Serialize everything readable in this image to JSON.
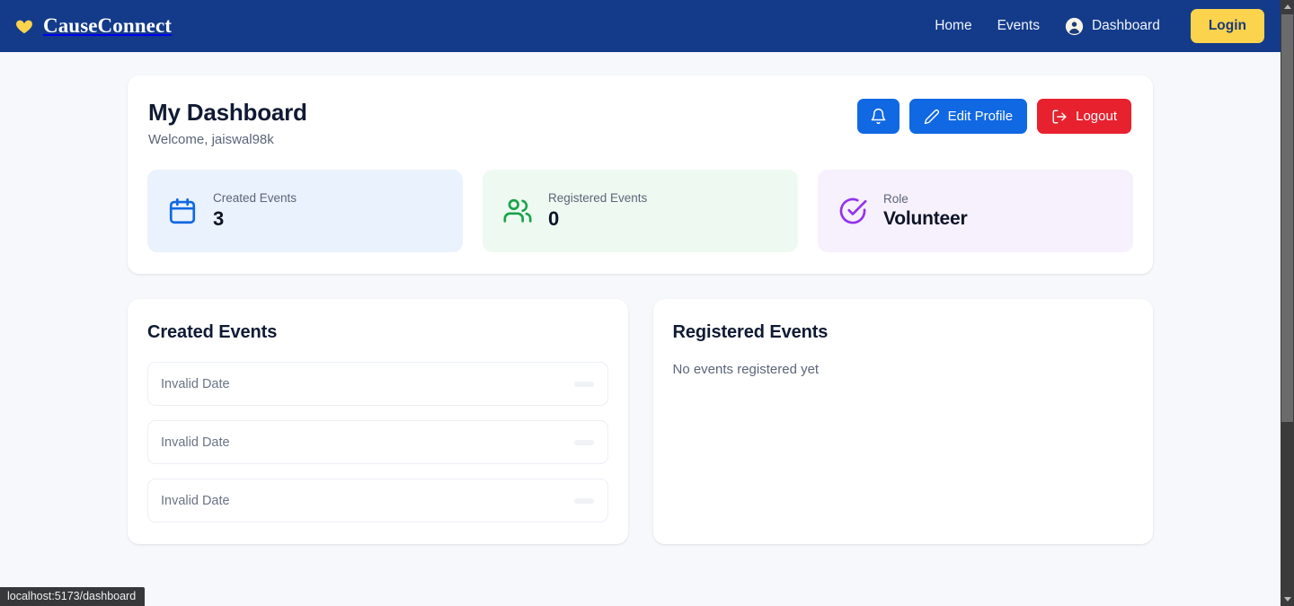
{
  "navbar": {
    "brand": "CauseConnect",
    "brand_icon": "heart-icon",
    "links": [
      {
        "label": "Home",
        "name": "home"
      },
      {
        "label": "Events",
        "name": "events"
      }
    ],
    "dashboard_label": "Dashboard",
    "dashboard_icon": "user-circle-icon",
    "login_label": "Login",
    "bg_color": "#143b8a",
    "login_bg": "#fcd34d",
    "heart_color": "#fcd34d"
  },
  "dashboard": {
    "title": "My Dashboard",
    "welcome": "Welcome, jaiswal98k",
    "buttons": {
      "notifications_icon": "bell-icon",
      "edit_profile_label": "Edit Profile",
      "edit_profile_icon": "pencil-icon",
      "logout_label": "Logout",
      "logout_icon": "sign-out-icon",
      "blue": "#1168e3",
      "red": "#e8212f"
    },
    "stats": [
      {
        "label": "Created Events",
        "value": "3",
        "icon": "calendar-icon",
        "icon_color": "#1168e3",
        "bg": "#eaf2fd"
      },
      {
        "label": "Registered Events",
        "value": "0",
        "icon": "users-icon",
        "icon_color": "#1aa34a",
        "bg": "#eefaf1"
      },
      {
        "label": "Role",
        "value": "Volunteer",
        "icon": "check-circle-icon",
        "icon_color": "#9333ea",
        "bg": "#f7f0fd"
      }
    ]
  },
  "created_events": {
    "title": "Created Events",
    "rows": [
      {
        "date": "Invalid Date",
        "badge": ""
      },
      {
        "date": "Invalid Date",
        "badge": ""
      },
      {
        "date": "Invalid Date",
        "badge": ""
      }
    ]
  },
  "registered_events": {
    "title": "Registered Events",
    "empty": "No events registered yet"
  },
  "browser": {
    "status_url": "localhost:5173/dashboard"
  }
}
